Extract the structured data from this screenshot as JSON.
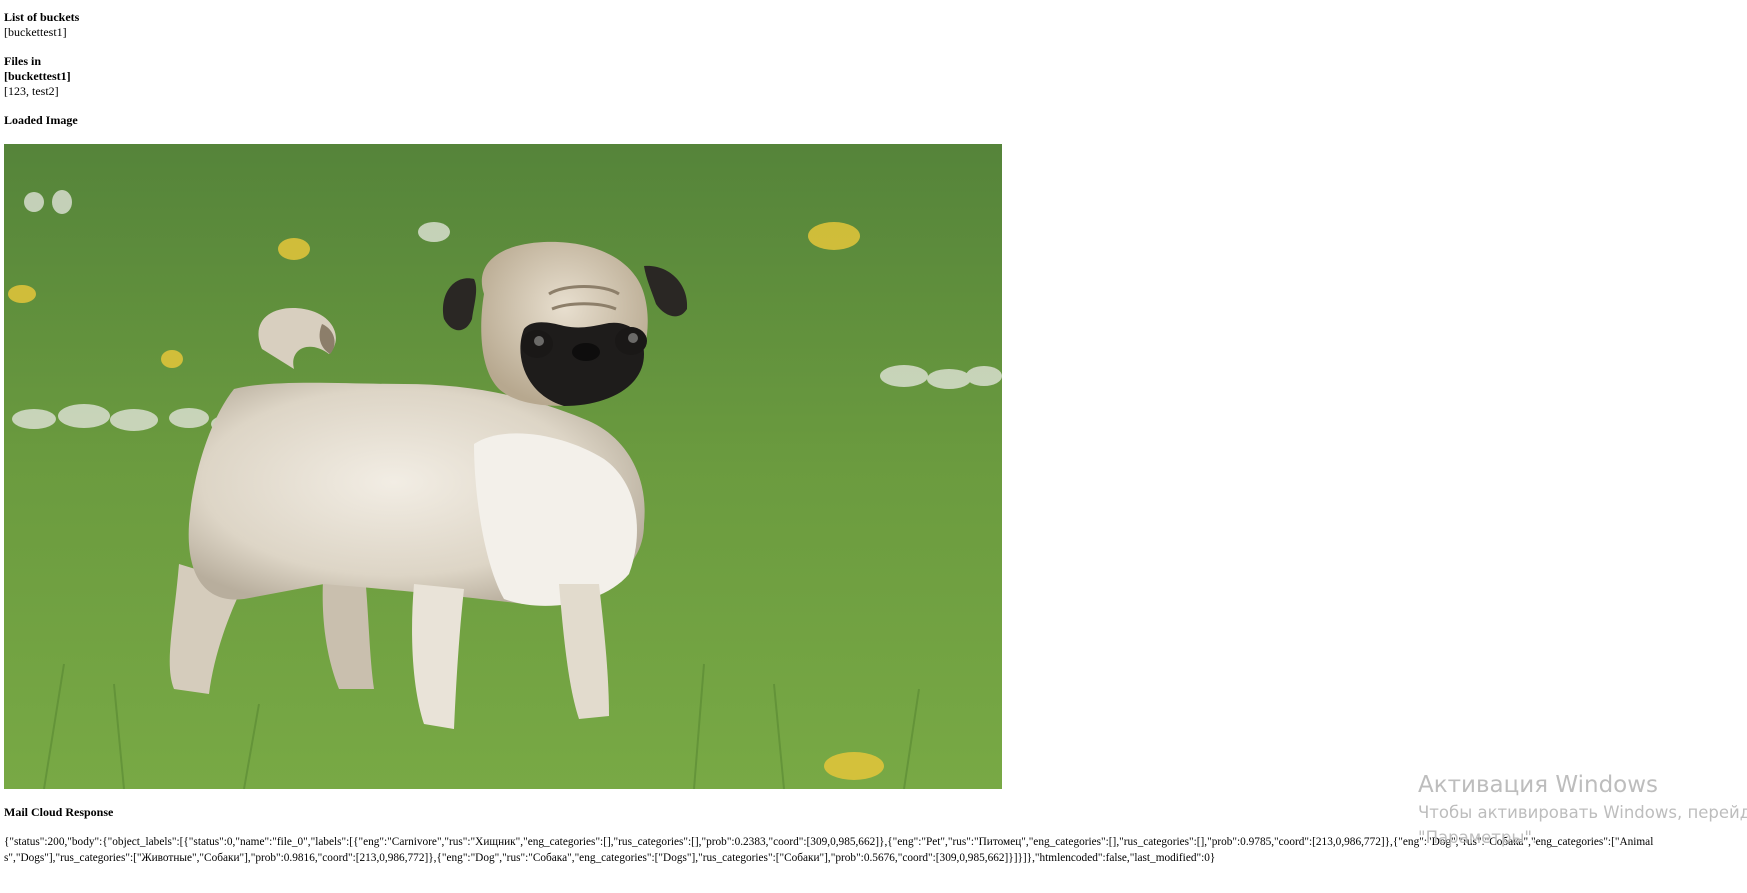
{
  "buckets": {
    "heading": "List of buckets",
    "value": "[buckettest1]"
  },
  "files": {
    "heading_line1": "Files in",
    "heading_line2": "[buckettest1]",
    "value": "[123, test2]"
  },
  "loaded_image": {
    "heading": "Loaded Image",
    "subject": "pug-dog-photo"
  },
  "response": {
    "heading": "Mail Cloud Response",
    "text": "{\"status\":200,\"body\":{\"object_labels\":[{\"status\":0,\"name\":\"file_0\",\"labels\":[{\"eng\":\"Carnivore\",\"rus\":\"Хищник\",\"eng_categories\":[],\"rus_categories\":[],\"prob\":0.2383,\"coord\":[309,0,985,662]},{\"eng\":\"Pet\",\"rus\":\"Питомец\",\"eng_categories\":[],\"rus_categories\":[],\"prob\":0.9785,\"coord\":[213,0,986,772]},{\"eng\":\"Dog\",\"rus\":\"Собака\",\"eng_categories\":[\"Animals\",\"Dogs\"],\"rus_categories\":[\"Животные\",\"Собаки\"],\"prob\":0.9816,\"coord\":[213,0,986,772]},{\"eng\":\"Dog\",\"rus\":\"Собака\",\"eng_categories\":[\"Dogs\"],\"rus_categories\":[\"Собаки\"],\"prob\":0.5676,\"coord\":[309,0,985,662]}]}]},\"htmlencoded\":false,\"last_modified\":0}"
  },
  "watermark": {
    "title": "Активация Windows",
    "line1": "Чтобы активировать Windows, перейди",
    "line2": "\"Параметры\"."
  }
}
